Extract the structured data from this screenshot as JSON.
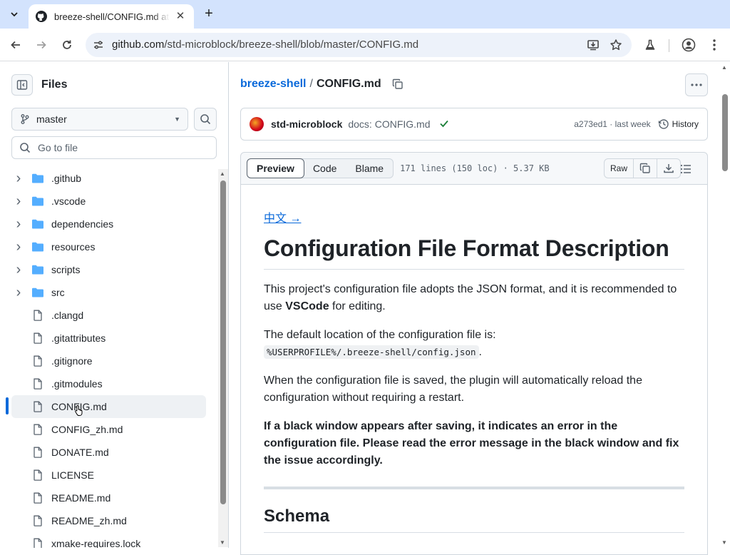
{
  "browser": {
    "tab_title": "breeze-shell/CONFIG.md at master · std-microblock/breeze-shell",
    "url_host": "github.com",
    "url_path": "/std-microblock/breeze-shell/blob/master/CONFIG.md"
  },
  "files_panel": {
    "title": "Files",
    "branch": "master",
    "goto_placeholder": "Go to file",
    "items": [
      {
        "type": "folder",
        "name": ".github"
      },
      {
        "type": "folder",
        "name": ".vscode"
      },
      {
        "type": "folder",
        "name": "dependencies"
      },
      {
        "type": "folder",
        "name": "resources"
      },
      {
        "type": "folder",
        "name": "scripts"
      },
      {
        "type": "folder",
        "name": "src"
      },
      {
        "type": "file",
        "name": ".clangd"
      },
      {
        "type": "file",
        "name": ".gitattributes"
      },
      {
        "type": "file",
        "name": ".gitignore"
      },
      {
        "type": "file",
        "name": ".gitmodules"
      },
      {
        "type": "file",
        "name": "CONFIG.md",
        "selected": true
      },
      {
        "type": "file",
        "name": "CONFIG_zh.md"
      },
      {
        "type": "file",
        "name": "DONATE.md"
      },
      {
        "type": "file",
        "name": "LICENSE"
      },
      {
        "type": "file",
        "name": "README.md"
      },
      {
        "type": "file",
        "name": "README_zh.md"
      },
      {
        "type": "file",
        "name": "xmake-requires.lock"
      }
    ]
  },
  "header": {
    "repo": "breeze-shell",
    "separator": "/",
    "file": "CONFIG.md"
  },
  "commit": {
    "author": "std-microblock",
    "message": "docs: CONFIG.md",
    "meta": "a273ed1 · last week",
    "history_label": "History"
  },
  "file_view": {
    "tabs": [
      "Preview",
      "Code",
      "Blame"
    ],
    "active_tab": "Preview",
    "stats": "171 lines (150 loc) · 5.37 KB",
    "raw_label": "Raw"
  },
  "doc": {
    "lang_link": "中文 →",
    "title": "Configuration File Format Description",
    "p1_a": "This project's configuration file adopts the JSON format, and it is recommended to use ",
    "p1_b": "VSCode",
    "p1_c": " for editing.",
    "p2_a": "The default location of the configuration file is:",
    "p2_code": "%USERPROFILE%/.breeze-shell/config.json",
    "p2_b": ".",
    "p3": "When the configuration file is saved, the plugin will automatically reload the configuration without requiring a restart.",
    "p4": "If a black window appears after saving, it indicates an error in the configuration file. Please read the error message in the black window and fix the issue accordingly.",
    "h2": "Schema"
  },
  "colors": {
    "accent_blue": "#0969da",
    "success_green": "#1a7f37",
    "folder_blue": "#54aeff",
    "tabstrip": "#d3e3fd"
  }
}
